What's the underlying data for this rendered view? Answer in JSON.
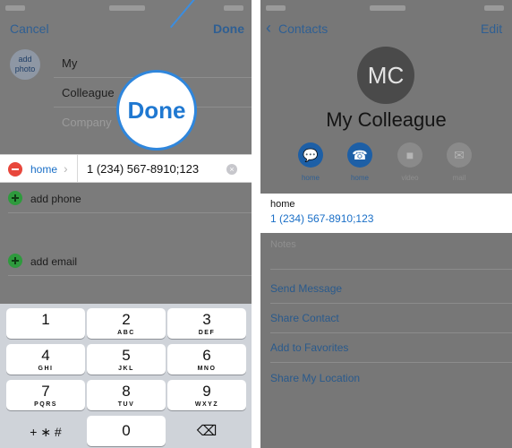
{
  "left_panel": {
    "nav": {
      "cancel": "Cancel",
      "done": "Done"
    },
    "add_photo": "add\nphoto",
    "fields": {
      "first_name": "My",
      "last_name": "Colleague",
      "company_placeholder": "Company"
    },
    "phone_row": {
      "label": "home",
      "number": "1 (234) 567-8910;123"
    },
    "add_phone": "add phone",
    "add_email": "add email",
    "callout_text": "Done",
    "keypad": {
      "keys": [
        {
          "num": "1",
          "letters": ""
        },
        {
          "num": "2",
          "letters": "ABC"
        },
        {
          "num": "3",
          "letters": "DEF"
        },
        {
          "num": "4",
          "letters": "GHI"
        },
        {
          "num": "5",
          "letters": "JKL"
        },
        {
          "num": "6",
          "letters": "MNO"
        },
        {
          "num": "7",
          "letters": "PQRS"
        },
        {
          "num": "8",
          "letters": "TUV"
        },
        {
          "num": "9",
          "letters": "WXYZ"
        },
        {
          "num": "0",
          "letters": ""
        }
      ],
      "symbols": "+ ∗ #",
      "delete_glyph": "⌫"
    }
  },
  "right_panel": {
    "nav": {
      "back": "Contacts",
      "edit": "Edit"
    },
    "initials": "MC",
    "name": "My Colleague",
    "actions": [
      {
        "label": "home",
        "icon": "message-icon",
        "glyph": "…",
        "active": true
      },
      {
        "label": "home",
        "icon": "phone-icon",
        "glyph": "☎",
        "active": true
      },
      {
        "label": "video",
        "icon": "video-icon",
        "glyph": "■",
        "active": false
      },
      {
        "label": "mail",
        "icon": "mail-icon",
        "glyph": "✉",
        "active": false
      }
    ],
    "phone_label": "home",
    "phone_number": "1 (234) 567-8910;123",
    "notes_label": "Notes",
    "menu": [
      "Send Message",
      "Share Contact",
      "Add to Favorites",
      "Share My Location"
    ]
  },
  "colors": {
    "accent_blue": "#1a6fc7",
    "delete_red": "#e8473c",
    "add_green": "#2e9a3d"
  }
}
